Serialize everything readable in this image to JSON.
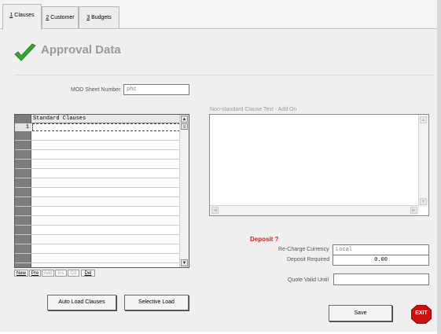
{
  "tabs": [
    {
      "hotkey": "1",
      "label": " Clauses"
    },
    {
      "hotkey": "2",
      "label": " Customer"
    },
    {
      "hotkey": "3",
      "label": " Budgets"
    }
  ],
  "header": {
    "title": "Approval Data"
  },
  "mod_sheet": {
    "label": "MOD Sheet Number",
    "value": "phc"
  },
  "grid": {
    "column_header": "Standard Clauses",
    "row_number": "1",
    "buttons": [
      {
        "label": "New",
        "enabled": true
      },
      {
        "label": "Pre",
        "enabled": true
      },
      {
        "label": "Add",
        "enabled": false
      },
      {
        "label": "Ins",
        "enabled": false
      },
      {
        "label": "Cd",
        "enabled": false
      },
      {
        "label": "Del",
        "enabled": true
      }
    ]
  },
  "nonstandard": {
    "label": "Non-standard Clause Text - Add On"
  },
  "deposit": {
    "heading": "Deposit ?",
    "recharge_label": "Re-Charge Currency",
    "recharge_value": "Local",
    "required_label": "Deposit Required",
    "required_value": "0.00",
    "quote_label": "Quote Valid Until",
    "quote_value": ""
  },
  "buttons": {
    "auto_load": "Auto Load Clauses",
    "selective_load": "Selective Load",
    "save": "Save",
    "exit": "EXIT"
  },
  "colors": {
    "accent_green": "#3aa52e",
    "deposit_red": "#d42020",
    "exit_red": "#cc1111"
  }
}
